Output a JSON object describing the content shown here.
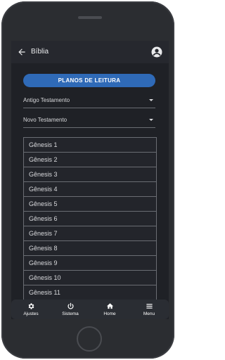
{
  "appbar": {
    "title": "Bíblia"
  },
  "plans_button": {
    "label": "PLANOS DE LEITURA"
  },
  "selects": {
    "old_testament": "Antigo Testamento",
    "new_testament": "Novo Testamento"
  },
  "chapters": [
    "Gênesis 1",
    "Gênesis 2",
    "Gênesis 3",
    "Gênesis 4",
    "Gênesis 5",
    "Gênesis 6",
    "Gênesis 7",
    "Gênesis 8",
    "Gênesis 9",
    "Gênesis 10",
    "Gênesis 11"
  ],
  "bottom_nav": [
    {
      "label": "Ajustes",
      "icon": "gear-icon"
    },
    {
      "label": "Sistema",
      "icon": "power-icon"
    },
    {
      "label": "Home",
      "icon": "home-icon"
    },
    {
      "label": "Menu",
      "icon": "hamburger-icon"
    }
  ],
  "colors": {
    "screen_bg": "#1f2126",
    "appbar_bg": "#26282e",
    "accent": "#2f6ab7",
    "border": "#6a6d73",
    "text": "#d8d9dc"
  }
}
